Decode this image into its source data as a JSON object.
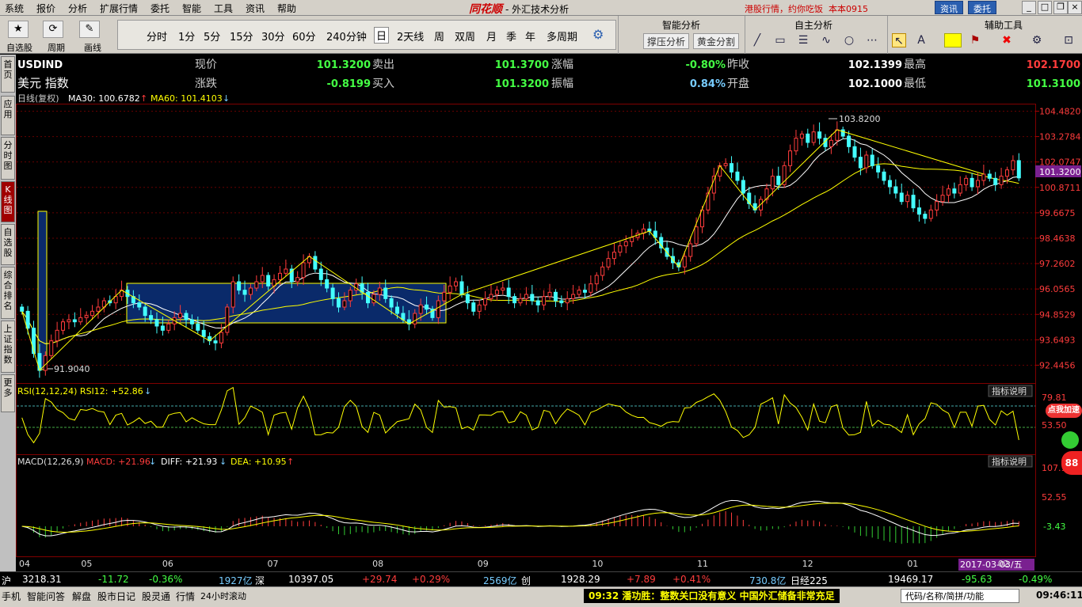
{
  "menubar": {
    "items": [
      "系统",
      "报价",
      "分析",
      "扩展行情",
      "委托",
      "智能",
      "工具",
      "资讯",
      "帮助"
    ],
    "brand": "同花顺",
    "title": "- 外汇技术分析",
    "ticker": "港股行情，约你吃饭",
    "ticker2": "本本0915",
    "btn_news": "资讯",
    "btn_trade": "委托"
  },
  "toolbar": {
    "captions": [
      "自选股",
      "周期",
      "画线"
    ],
    "periods": [
      "分时",
      "1分",
      "5分",
      "15分",
      "30分",
      "60分",
      "240分钟",
      "日",
      "2天线",
      "周",
      "双周",
      "月",
      "季",
      "年",
      "多周期"
    ],
    "selected_period": "日",
    "smart_title": "智能分析",
    "smart_btns": [
      "撑压分析",
      "黄金分割"
    ],
    "self_title": "自主分析",
    "aux_title": "辅助工具"
  },
  "sidetabs": [
    "首页",
    "应用",
    "分时图",
    "K线图",
    "自选股",
    "综合排名",
    "上证指数",
    "更多"
  ],
  "quote": {
    "code": "USDIND",
    "name": "美元 指数",
    "labels": {
      "now": "现价",
      "change": "涨跌",
      "sell": "卖出",
      "buy": "买入",
      "pct": "涨幅",
      "amp": "振幅",
      "prev": "昨收",
      "open": "开盘",
      "high": "最高",
      "low": "最低"
    },
    "now": "101.3200",
    "change": "-0.8199",
    "sell": "101.3700",
    "buy": "101.3200",
    "pct": "-0.80%",
    "amp": "0.84%",
    "prev": "102.1399",
    "open": "102.1000",
    "high": "102.1700",
    "low": "101.3100"
  },
  "chart_data": {
    "type": "candlestick",
    "symbol": "USDIND",
    "period": "日线(复权)",
    "ma_legend": {
      "ma30": "MA30: 100.6782",
      "ma60": "MA60: 101.4103"
    },
    "y_ticks": [
      "104.4820",
      "103.2784",
      "102.0747",
      "100.8711",
      "99.6675",
      "98.4638",
      "97.2602",
      "96.0565",
      "94.8529",
      "93.6493",
      "92.4456"
    ],
    "ylim": [
      91.6,
      104.8
    ],
    "current_price_tag": "101.3200",
    "x_ticks": [
      "04",
      "05",
      "06",
      "07",
      "08",
      "09",
      "10",
      "11",
      "12",
      "01",
      "02"
    ],
    "peak_label": "103.8200",
    "trough_label": "91.9040",
    "closes": [
      95.0,
      94.2,
      93.0,
      92.2,
      92.9,
      93.6,
      94.1,
      94.5,
      94.6,
      94.5,
      94.7,
      94.8,
      95.0,
      95.2,
      95.5,
      95.4,
      95.7,
      96.0,
      95.7,
      95.4,
      95.2,
      94.8,
      94.6,
      94.3,
      94.1,
      94.4,
      94.7,
      94.9,
      94.6,
      94.4,
      94.1,
      93.8,
      93.6,
      93.5,
      94.0,
      95.2,
      96.4,
      96.0,
      95.8,
      96.1,
      96.4,
      96.7,
      96.2,
      96.5,
      96.8,
      97.0,
      96.4,
      96.6,
      97.3,
      97.6,
      97.0,
      96.5,
      96.1,
      95.6,
      95.2,
      95.5,
      96.0,
      96.3,
      95.9,
      95.4,
      95.8,
      96.1,
      95.6,
      95.2,
      94.9,
      94.6,
      94.4,
      94.9,
      95.3,
      95.1,
      94.7,
      95.5,
      95.9,
      96.2,
      96.4,
      95.8,
      95.4,
      95.0,
      95.3,
      95.6,
      95.8,
      96.0,
      96.1,
      95.7,
      95.4,
      95.6,
      95.8,
      95.5,
      95.3,
      95.7,
      95.9,
      95.5,
      95.4,
      95.6,
      95.8,
      96.0,
      95.9,
      96.3,
      96.7,
      97.1,
      97.5,
      97.8,
      98.1,
      98.3,
      98.5,
      98.7,
      98.9,
      98.8,
      98.5,
      98.0,
      97.6,
      97.3,
      97.1,
      97.6,
      98.2,
      99.0,
      99.8,
      100.6,
      101.4,
      101.9,
      102.0,
      101.6,
      101.2,
      100.6,
      100.1,
      99.8,
      100.3,
      100.8,
      101.4,
      101.0,
      101.9,
      102.6,
      103.2,
      103.4,
      103.0,
      103.5,
      103.2,
      102.8,
      103.1,
      103.6,
      103.3,
      102.8,
      102.3,
      101.8,
      102.4,
      101.9,
      101.6,
      101.2,
      100.9,
      100.6,
      100.2,
      100.5,
      99.9,
      99.6,
      99.4,
      99.8,
      100.2,
      100.5,
      100.8,
      100.6,
      101.0,
      101.3,
      100.9,
      101.2,
      101.5,
      101.3,
      101.0,
      101.4,
      101.7,
      102.14,
      101.32
    ],
    "rsi_legend": "RSI(12,12,24) RSI12: +52.86",
    "rsi_ticks": [
      "79.81",
      "53.50"
    ],
    "macd_legend": {
      "label": "MACD(12,26,9)",
      "macd": "MACD: +21.96",
      "diff": "DIFF: +21.93",
      "dea": "DEA: +10.95"
    },
    "macd_ticks": [
      "107.1",
      "52.55",
      "-3.43"
    ],
    "indicator_btn": "指标说明",
    "date_tag": "2017-03-03/五"
  },
  "statusbar": {
    "sh_label": "沪",
    "sh": "3218.31",
    "sh_chg": "-11.72",
    "sh_pct": "-0.36%",
    "sh_vol": "1927亿",
    "sz_label": "深",
    "sz": "10397.05",
    "sz_chg": "+29.74",
    "sz_pct": "+0.29%",
    "sz_vol": "2569亿",
    "cy_label": "创",
    "cy": "1928.29",
    "cy_chg": "+7.89",
    "cy_pct": "+0.41%",
    "cy_vol": "730.8亿",
    "rj_label": "日经225",
    "rj": "19469.17",
    "rj_chg": "-95.63",
    "rj_pct": "-0.49%"
  },
  "bottombar": {
    "items": [
      "手机",
      "智能问答",
      "解盘",
      "股市日记",
      "股灵通",
      "行情",
      "24小时滚动"
    ],
    "news_time": "09:32",
    "news_src": "潘功胜：",
    "news_text": "整数关口没有意义 中国外汇储备非常充足",
    "search_placeholder": "代码/名称/简拼/功能",
    "clock": "09:46:11"
  },
  "promo": {
    "badge": "点我加速",
    "num": "88"
  }
}
